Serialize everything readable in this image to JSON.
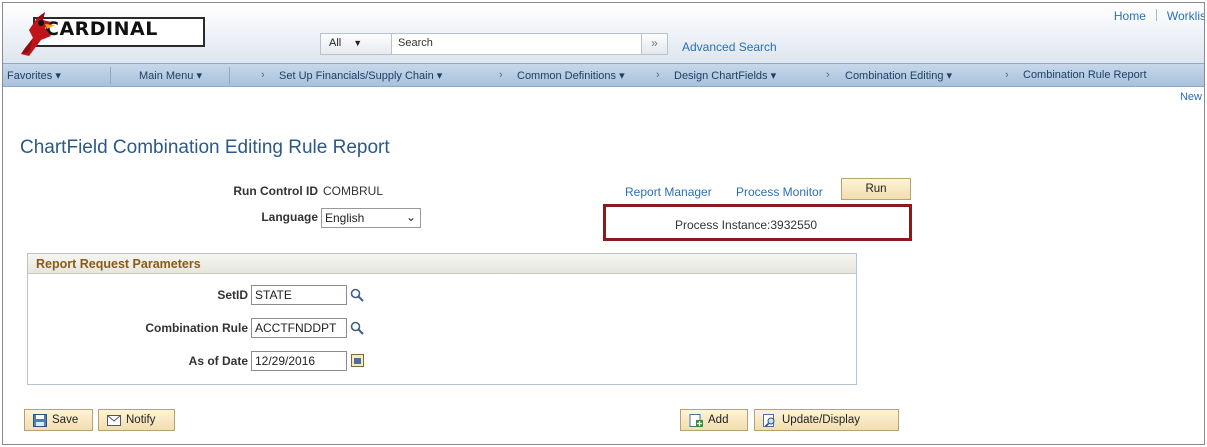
{
  "header": {
    "logo_text": "CARDINAL",
    "search_scope": "All",
    "search_placeholder": "Search",
    "advanced_search": "Advanced Search",
    "top_links": [
      "Home",
      "Worklis"
    ]
  },
  "nav": {
    "favorites": "Favorites",
    "main_menu": "Main Menu",
    "breadcrumbs": [
      "Set Up Financials/Supply Chain",
      "Common Definitions",
      "Design ChartFields",
      "Combination Editing",
      "Combination Rule Report"
    ],
    "new_window": "New"
  },
  "page": {
    "title": "ChartField Combination Editing Rule Report",
    "run_control_label": "Run Control ID",
    "run_control_value": "COMBRUL",
    "language_label": "Language",
    "language_value": "English",
    "report_manager": "Report Manager",
    "process_monitor": "Process Monitor",
    "run_button": "Run",
    "process_instance": "Process Instance:3932550"
  },
  "params": {
    "heading": "Report Request Parameters",
    "setid_label": "SetID",
    "setid_value": "STATE",
    "rule_label": "Combination Rule",
    "rule_value": "ACCTFNDDPT",
    "date_label": "As of Date",
    "date_value": "12/29/2016"
  },
  "footer": {
    "save": "Save",
    "notify": "Notify",
    "add": "Add",
    "update_display": "Update/Display"
  },
  "colors": {
    "highlight_border": "#8b1a1a",
    "link": "#2a6fb8",
    "section_heading": "#8a5a1a"
  }
}
